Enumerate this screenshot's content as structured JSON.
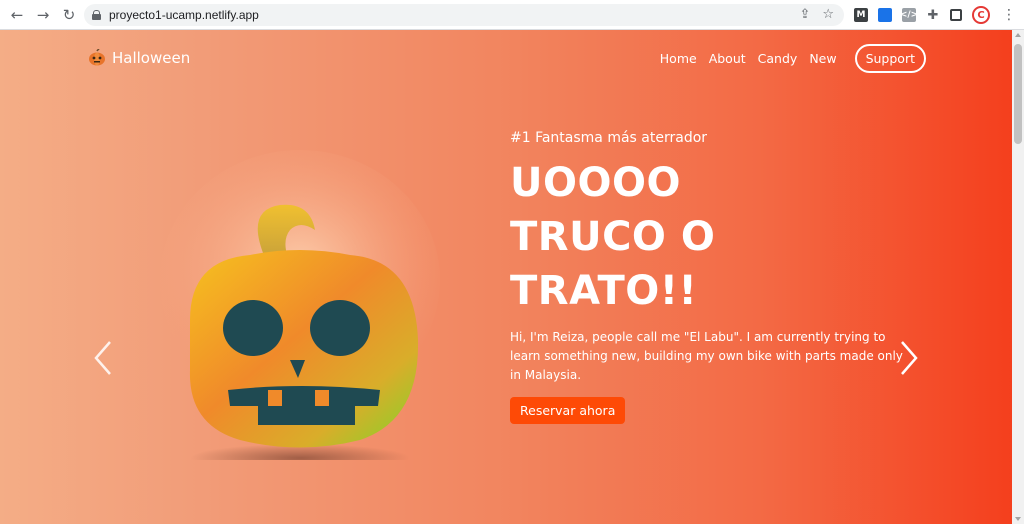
{
  "browser": {
    "url": "proyecto1-ucamp.netlify.app",
    "extensions": [
      "M",
      "ext-blue",
      "</>"
    ],
    "profile_initial": "C"
  },
  "site": {
    "logo_text": "Halloween",
    "nav": {
      "home": "Home",
      "about": "About",
      "candy": "Candy",
      "new": "New",
      "support": "Support"
    }
  },
  "hero": {
    "kicker": "#1 Fantasma más aterrador",
    "headline_line1": "UOOOO",
    "headline_line2": "TRUCO O",
    "headline_line3": "TRATO!!",
    "blurb": "Hi, I'm Reiza, people call me \"El Labu\". I am currently trying to learn something new, building my own bike with parts made only in Malaysia.",
    "cta": "Reservar ahora"
  },
  "colors": {
    "gradient_start": "#f4ad86",
    "gradient_end": "#f43f1d",
    "cta_bg": "#fe4a06",
    "text": "#ffffff"
  }
}
